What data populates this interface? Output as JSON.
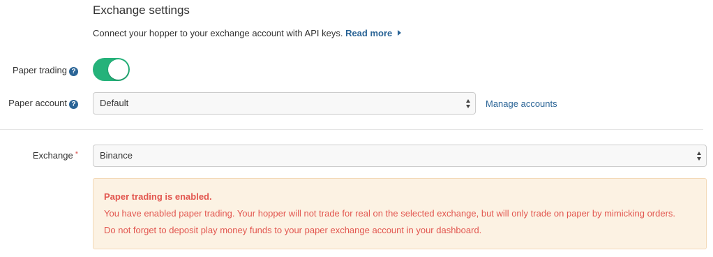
{
  "section": {
    "title": "Exchange settings",
    "description": "Connect your hopper to your exchange account with API keys.",
    "read_more_label": "Read more"
  },
  "paper_trading": {
    "label": "Paper trading",
    "enabled": true
  },
  "paper_account": {
    "label": "Paper account",
    "selected": "Default",
    "manage_link": "Manage accounts"
  },
  "exchange": {
    "label": "Exchange",
    "required_marker": "*",
    "selected": "Binance"
  },
  "alert": {
    "title": "Paper trading is enabled.",
    "line1": "You have enabled paper trading. Your hopper will not trade for real on the selected exchange, but will only trade on paper by mimicking orders.",
    "line2": "Do not forget to deposit play money funds to your paper exchange account in your dashboard."
  },
  "colors": {
    "toggle_on": "#25b27a",
    "link": "#2a6496",
    "alert_text": "#e2564f",
    "alert_bg": "#fcf2e3",
    "required": "#d9534f"
  }
}
